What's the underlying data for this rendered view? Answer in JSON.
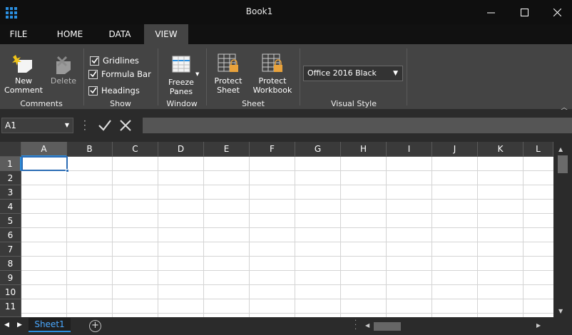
{
  "window": {
    "title": "Book1"
  },
  "tabs": [
    {
      "label": "FILE"
    },
    {
      "label": "HOME"
    },
    {
      "label": "DATA"
    },
    {
      "label": "VIEW"
    }
  ],
  "ribbon": {
    "comments": {
      "new_line1": "New",
      "new_line2": "Comment",
      "delete": "Delete",
      "label": "Comments"
    },
    "show": {
      "gridlines": "Gridlines",
      "formula_bar": "Formula Bar",
      "headings": "Headings",
      "label": "Show"
    },
    "window": {
      "freeze_line1": "Freeze",
      "freeze_line2": "Panes",
      "label": "Window"
    },
    "sheet": {
      "protect_sheet_line1": "Protect",
      "protect_sheet_line2": "Sheet",
      "protect_wb_line1": "Protect",
      "protect_wb_line2": "Workbook",
      "label": "Sheet"
    },
    "visual_style": {
      "value": "Office 2016 Black",
      "label": "Visual Style"
    }
  },
  "formula_bar": {
    "name_box": "A1",
    "value": ""
  },
  "columns": [
    "A",
    "B",
    "C",
    "D",
    "E",
    "F",
    "G",
    "H",
    "I",
    "J",
    "K",
    "L"
  ],
  "rows": [
    "1",
    "2",
    "3",
    "4",
    "5",
    "6",
    "7",
    "8",
    "9",
    "10",
    "11"
  ],
  "sheets": [
    {
      "name": "Sheet1"
    }
  ],
  "colors": {
    "accent": "#2b8fe0",
    "ribbon": "#444444",
    "titlebar": "#0f0f0f"
  }
}
